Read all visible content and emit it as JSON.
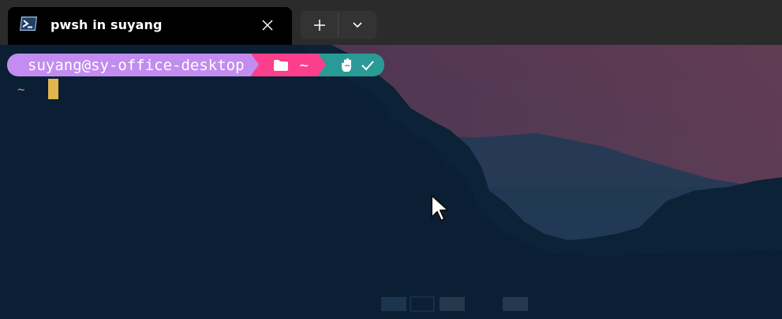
{
  "tab": {
    "title": "pwsh in suyang",
    "icon": "powershell-icon"
  },
  "controls": {
    "new_tab_icon": "plus-icon",
    "dropdown_icon": "chevron-down-icon",
    "close_icon": "close-icon"
  },
  "prompt": {
    "user_host": "suyang@sy-office-desktop",
    "path_icon": "folder-icon",
    "path": "~",
    "status_icon": "hand-icon",
    "status_ok_icon": "check-icon",
    "colors": {
      "user_bg": "#c38cf0",
      "path_bg": "#fb3f8d",
      "status_bg": "#2a9a96"
    }
  },
  "input_line": {
    "prefix": "~"
  },
  "colors": {
    "titlebar": "#2b2b2b",
    "active_tab": "#000000",
    "cursor": "#e1b54d"
  }
}
